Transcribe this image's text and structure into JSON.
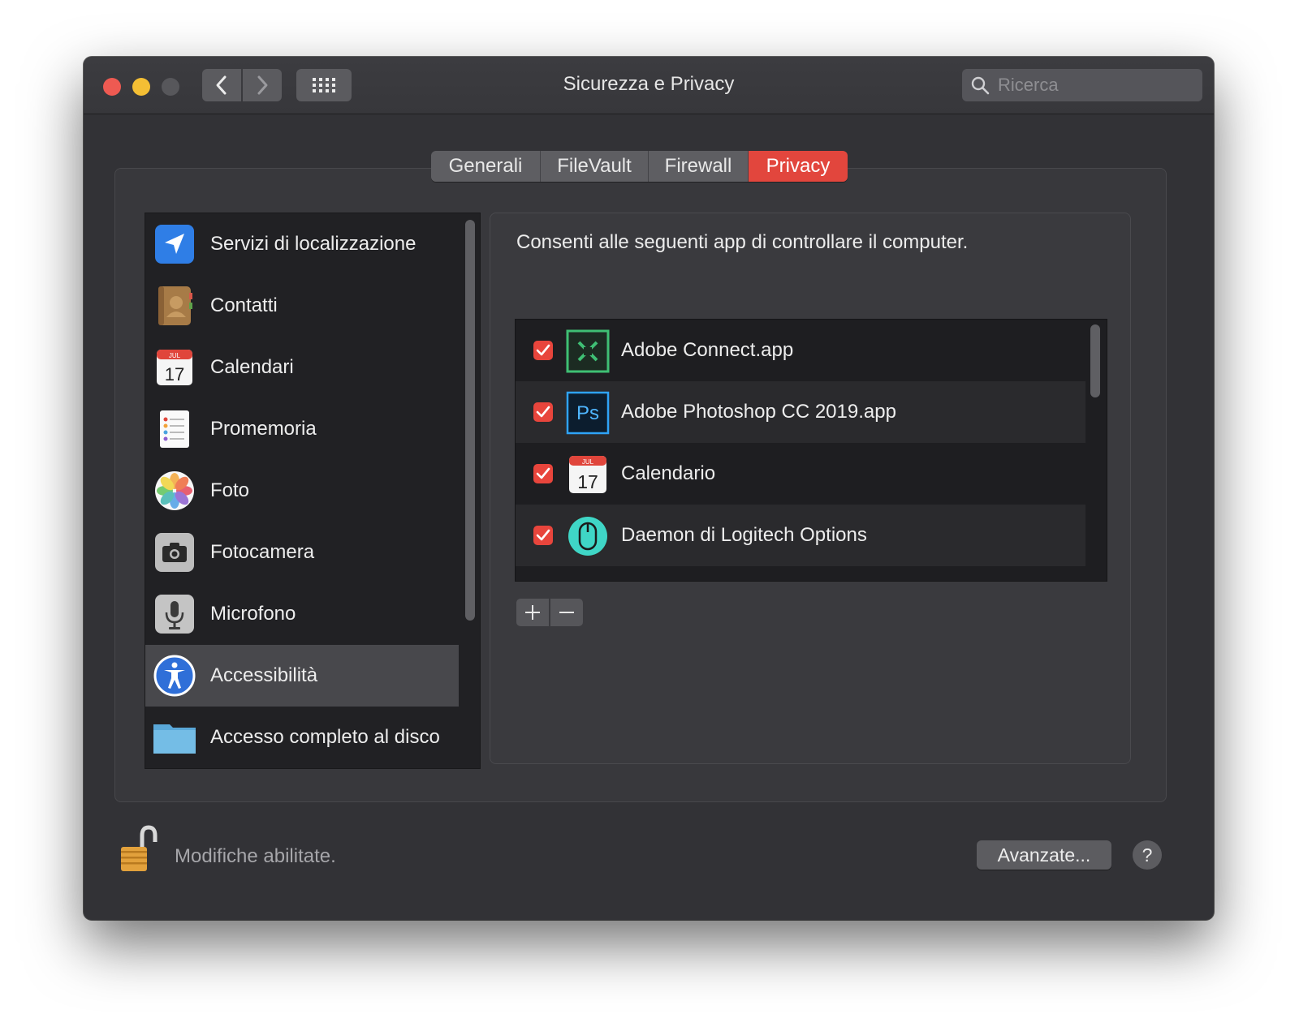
{
  "window": {
    "title": "Sicurezza e Privacy",
    "search_placeholder": "Ricerca"
  },
  "tabs": [
    {
      "label": "Generali",
      "active": false
    },
    {
      "label": "FileVault",
      "active": false
    },
    {
      "label": "Firewall",
      "active": false
    },
    {
      "label": "Privacy",
      "active": true
    }
  ],
  "sidebar": {
    "items": [
      {
        "label": "Servizi di localizzazione",
        "icon": "location-arrow-icon",
        "selected": false
      },
      {
        "label": "Contatti",
        "icon": "contacts-book-icon",
        "selected": false
      },
      {
        "label": "Calendari",
        "icon": "calendar-icon",
        "selected": false
      },
      {
        "label": "Promemoria",
        "icon": "reminders-icon",
        "selected": false
      },
      {
        "label": "Foto",
        "icon": "photos-flower-icon",
        "selected": false
      },
      {
        "label": "Fotocamera",
        "icon": "camera-icon",
        "selected": false
      },
      {
        "label": "Microfono",
        "icon": "microphone-icon",
        "selected": false
      },
      {
        "label": "Accessibilità",
        "icon": "accessibility-icon",
        "selected": true
      },
      {
        "label": "Accesso completo al disco",
        "icon": "folder-icon",
        "selected": false
      }
    ]
  },
  "main": {
    "instruction": "Consenti alle seguenti app di controllare il computer.",
    "apps": [
      {
        "name": "Adobe Connect.app",
        "checked": true,
        "icon": "adobe-connect-icon"
      },
      {
        "name": "Adobe Photoshop CC 2019.app",
        "checked": true,
        "icon": "photoshop-icon"
      },
      {
        "name": "Calendario",
        "checked": true,
        "icon": "calendar-icon"
      },
      {
        "name": "Daemon di Logitech Options",
        "checked": true,
        "icon": "logitech-mouse-icon"
      }
    ],
    "calendar_icon": {
      "month": "JUL",
      "day": "17"
    },
    "photoshop_icon_text": "Ps"
  },
  "footer": {
    "lock_text": "Modifiche abilitate.",
    "advanced_button": "Avanzate...",
    "help_button": "?"
  },
  "colors": {
    "accent": "#e2463d",
    "window_bg": "#323236",
    "sidebar_bg": "#212124"
  }
}
